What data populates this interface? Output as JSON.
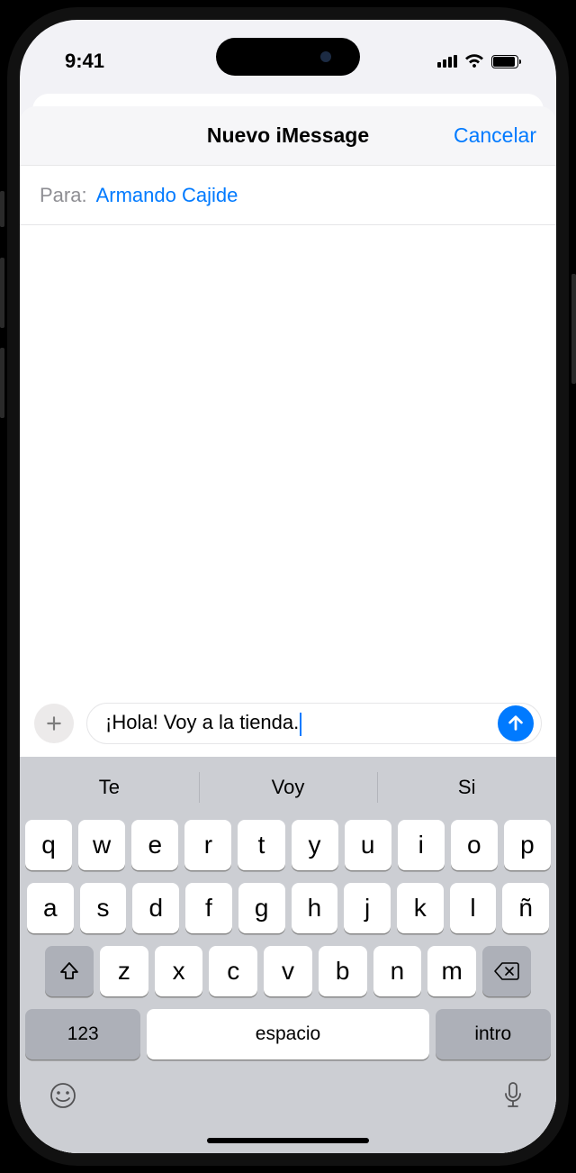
{
  "status_bar": {
    "time": "9:41"
  },
  "header": {
    "title": "Nuevo iMessage",
    "cancel": "Cancelar"
  },
  "to_field": {
    "label": "Para:",
    "recipient": "Armando Cajide"
  },
  "message_input": {
    "text": "¡Hola! Voy a la tienda."
  },
  "keyboard": {
    "suggestions": [
      "Te",
      "Voy",
      "Si"
    ],
    "row1": [
      "q",
      "w",
      "e",
      "r",
      "t",
      "y",
      "u",
      "i",
      "o",
      "p"
    ],
    "row2": [
      "a",
      "s",
      "d",
      "f",
      "g",
      "h",
      "j",
      "k",
      "l",
      "ñ"
    ],
    "row3": [
      "z",
      "x",
      "c",
      "v",
      "b",
      "n",
      "m"
    ],
    "num_key": "123",
    "space": "espacio",
    "return": "intro"
  }
}
